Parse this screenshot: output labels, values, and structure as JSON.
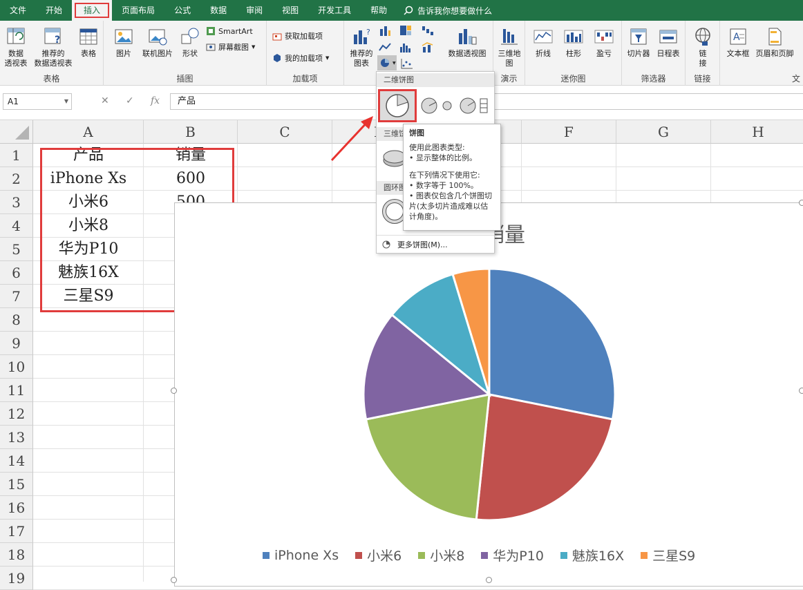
{
  "tabs": [
    "文件",
    "开始",
    "插入",
    "页面布局",
    "公式",
    "数据",
    "审阅",
    "视图",
    "开发工具",
    "帮助"
  ],
  "tell_me": "告诉我你想要做什么",
  "ribbon": {
    "pivot": "数据\n透视表",
    "rec_pivot": "推荐的\n数据透视表",
    "table": "表格",
    "group_table": "表格",
    "picture": "图片",
    "online_picture": "联机图片",
    "shapes": "形状",
    "smartart": "SmartArt",
    "screenshot": "屏幕截图",
    "group_illus": "插图",
    "get_addins": "获取加载项",
    "my_addins": "我的加载项",
    "group_addins": "加载项",
    "rec_charts": "推荐的\n图表",
    "pivotchart": "数据透视图",
    "map3d": "三维地\n图",
    "group_tour": "演示",
    "line": "折线",
    "column": "柱形",
    "winloss": "盈亏",
    "group_spark": "迷你图",
    "slicer": "切片器",
    "timeline": "日程表",
    "group_filter": "筛选器",
    "link": "链\n接",
    "group_link": "链接",
    "textbox": "文本框",
    "headerfooter": "页眉和页脚",
    "group_text": "文"
  },
  "namebox": "A1",
  "formula": "产品",
  "columns": [
    "A",
    "B",
    "C",
    "D",
    "E",
    "F",
    "G",
    "H"
  ],
  "rows": [
    "1",
    "2",
    "3",
    "4",
    "5",
    "6",
    "7",
    "8",
    "9",
    "10",
    "11",
    "12",
    "13",
    "14",
    "15",
    "16",
    "17",
    "18",
    "19"
  ],
  "cells": {
    "a1": "产品",
    "b1": "销量",
    "a2": "iPhone Xs",
    "b2": "600",
    "a3": "小米6",
    "b3": "500",
    "a4": "小米8",
    "a5": "华为P10",
    "a6": "魅族16X",
    "a7": "三星S9"
  },
  "chart_data": {
    "type": "pie",
    "title": "销量",
    "categories": [
      "iPhone Xs",
      "小米6",
      "小米8",
      "华为P10",
      "魅族16X",
      "三星S9"
    ],
    "values": [
      600,
      500,
      430,
      300,
      200,
      100
    ],
    "colors": [
      "#4f81bd",
      "#c0504d",
      "#9bbb59",
      "#8064a2",
      "#4bacc6",
      "#f79646"
    ],
    "legend": "bottom"
  },
  "dropdown": {
    "sec2d": "二维饼图",
    "sec3d": "三维饼图",
    "donut": "圆环图",
    "more": "更多饼图(M)..."
  },
  "tooltip": {
    "title": "饼图",
    "l1": "使用此图表类型:",
    "l2": "• 显示整体的比例。",
    "l3": "在下列情况下使用它:",
    "l4": "• 数字等于 100%。",
    "l5": "• 图表仅包含几个饼图切片(太多切片造成难以估计角度)。"
  }
}
